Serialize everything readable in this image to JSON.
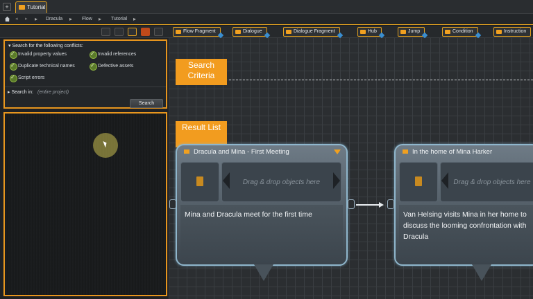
{
  "tabstrip": {
    "add_label": "+",
    "doc_tab": "Tutorial"
  },
  "breadcrumb": {
    "items": [
      "Dracula",
      "Flow",
      "Tutorial"
    ],
    "separator": "▸"
  },
  "toolbar": {
    "tools": [
      "Flow Fragment",
      "Dialogue",
      "Dialogue Fragment",
      "Hub",
      "Jump",
      "Condition",
      "Instruction"
    ]
  },
  "search": {
    "title": "Search for the following conflicts:",
    "options": [
      {
        "label": "Invalid property values",
        "checked": true
      },
      {
        "label": "Invalid references",
        "checked": true
      },
      {
        "label": "Duplicate technical names",
        "checked": true
      },
      {
        "label": "Defective assets",
        "checked": true
      },
      {
        "label": "Script errors",
        "checked": true
      }
    ],
    "search_in_label": "Search in:",
    "search_in_value": "(entire project)",
    "button": "Search"
  },
  "callouts": {
    "criteria": "Search Criteria",
    "results": "Result List"
  },
  "nodes": [
    {
      "title": "Dracula and Mina - First Meeting",
      "drop_hint": "Drag & drop objects here",
      "text": "Mina and Dracula meet for the first time"
    },
    {
      "title": "In the home of Mina Harker",
      "drop_hint": "Drag & drop objects here",
      "text": "Van Helsing visits Mina in her home to discuss the looming confrontation with Dracula"
    }
  ],
  "colors": {
    "accent": "#e8961e",
    "node_border": "#8fb6cc",
    "check": "#8ab040"
  },
  "icons": [
    "home-icon",
    "folder-icon",
    "search-icon",
    "flag-icon",
    "check-icon"
  ]
}
